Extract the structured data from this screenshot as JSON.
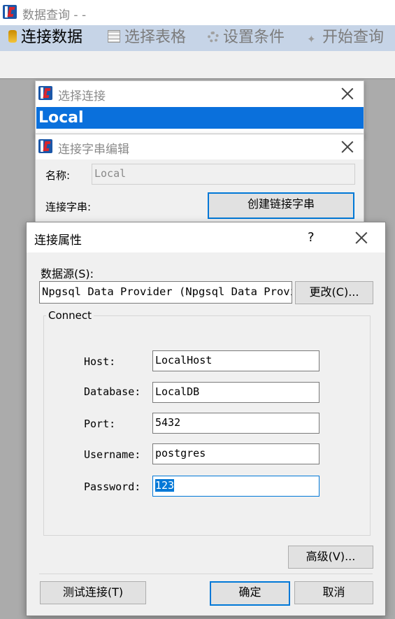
{
  "app": {
    "title": "数据查询 - -"
  },
  "toolbar": {
    "connect_label": "连接数据",
    "select_table_label": "选择表格",
    "set_conditions_label": "设置条件",
    "start_query_label": "开始查询"
  },
  "select_conn": {
    "title": "选择连接",
    "selected_item": "Local"
  },
  "conn_edit": {
    "title": "连接字串编辑",
    "name_label": "名称:",
    "name_value": "Local",
    "conn_str_label": "连接字串:",
    "create_button": "创建链接字串"
  },
  "props": {
    "title": "连接属性",
    "help": "?",
    "datasource_label": "数据源(S):",
    "datasource_value": "Npgsql Data Provider (Npgsql Data Provi",
    "change_button": "更改(C)...",
    "group_label": "Connect",
    "fields": [
      {
        "label": "Host:",
        "value": "LocalHost"
      },
      {
        "label": "Database:",
        "value": "LocalDB"
      },
      {
        "label": "Port:",
        "value": "5432"
      },
      {
        "label": "Username:",
        "value": "postgres"
      },
      {
        "label": "Password:",
        "value": "123"
      }
    ],
    "advanced_button": "高级(V)...",
    "test_button": "测试连接(T)",
    "ok_button": "确定",
    "cancel_button": "取消"
  },
  "colors": {
    "accent": "#0078d7",
    "toolbar_bg": "#c6d4e7",
    "selection": "#0a70dc"
  }
}
